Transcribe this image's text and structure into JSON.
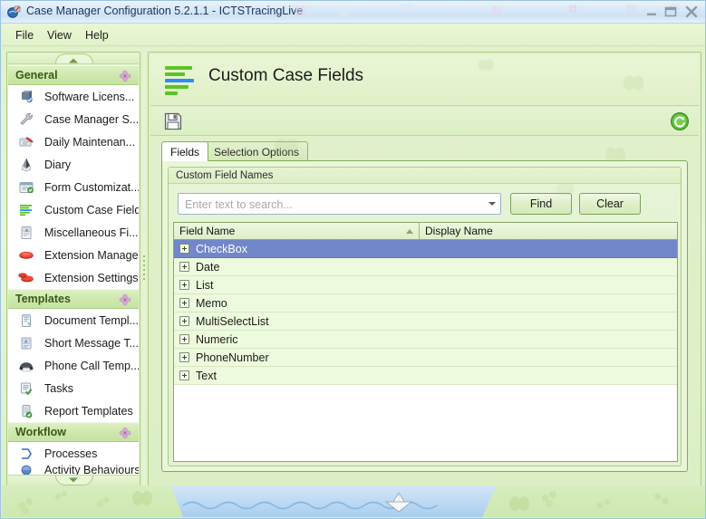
{
  "window": {
    "title": "Case Manager Configuration 5.2.1.1 - ICTSTracingLive",
    "app_icon": "app-icon",
    "controls": {
      "minimize": "minimize-button",
      "maximize": "maximize-button",
      "close": "close-button"
    }
  },
  "menubar": {
    "items": [
      {
        "label": "File"
      },
      {
        "label": "View"
      },
      {
        "label": "Help"
      }
    ]
  },
  "sidebar": {
    "scroll_up": "scroll-up-arrow",
    "scroll_down": "scroll-down-arrow",
    "groups": [
      {
        "title": "General",
        "icon": "flower-icon",
        "items": [
          {
            "label": "Software Licens...",
            "icon": "software-license-icon"
          },
          {
            "label": "Case Manager S...",
            "icon": "wrench-icon"
          },
          {
            "label": "Daily Maintenan...",
            "icon": "maintenance-icon"
          },
          {
            "label": "Diary",
            "icon": "diary-icon"
          },
          {
            "label": "Form Customizat...",
            "icon": "form-customization-icon"
          },
          {
            "label": "Custom Case Fields",
            "icon": "custom-case-fields-icon"
          },
          {
            "label": "Miscellaneous Fi...",
            "icon": "miscellaneous-files-icon"
          },
          {
            "label": "Extension Manager",
            "icon": "extension-manager-icon"
          },
          {
            "label": "Extension Settings",
            "icon": "extension-settings-icon"
          }
        ]
      },
      {
        "title": "Templates",
        "icon": "flower-icon",
        "items": [
          {
            "label": "Document Templ...",
            "icon": "document-template-icon"
          },
          {
            "label": "Short Message T...",
            "icon": "short-message-template-icon"
          },
          {
            "label": "Phone Call Temp...",
            "icon": "phone-call-template-icon"
          },
          {
            "label": "Tasks",
            "icon": "tasks-icon"
          },
          {
            "label": "Report Templates",
            "icon": "report-templates-icon"
          }
        ]
      },
      {
        "title": "Workflow",
        "icon": "flower-icon",
        "items": [
          {
            "label": "Processes",
            "icon": "processes-icon"
          },
          {
            "label": "Activity Behaviours",
            "icon": "activity-behaviours-icon"
          }
        ]
      }
    ]
  },
  "main": {
    "page_title": "Custom Case Fields",
    "page_icon": "custom-case-fields-icon",
    "toolbar": {
      "save_label": "Save",
      "save_icon": "save-floppy-icon",
      "refresh_label": "Refresh",
      "refresh_icon": "refresh-icon"
    },
    "tabs": [
      {
        "label": "Fields",
        "active": true
      },
      {
        "label": "Selection Options",
        "active": false
      }
    ],
    "group_title": "Custom Field Names",
    "search": {
      "value": "",
      "placeholder": "Enter text to search...",
      "find_label": "Find",
      "clear_label": "Clear"
    },
    "table": {
      "columns": [
        {
          "label": "Field Name",
          "sort": "asc"
        },
        {
          "label": "Display Name",
          "sort": "none"
        }
      ],
      "rows": [
        {
          "field_name": "CheckBox",
          "display_name": "",
          "selected": true
        },
        {
          "field_name": "Date",
          "display_name": "",
          "selected": false
        },
        {
          "field_name": "List",
          "display_name": "",
          "selected": false
        },
        {
          "field_name": "Memo",
          "display_name": "",
          "selected": false
        },
        {
          "field_name": "MultiSelectList",
          "display_name": "",
          "selected": false
        },
        {
          "field_name": "Numeric",
          "display_name": "",
          "selected": false
        },
        {
          "field_name": "PhoneNumber",
          "display_name": "",
          "selected": false
        },
        {
          "field_name": "Text",
          "display_name": "",
          "selected": false
        }
      ]
    }
  },
  "theme": {
    "accent_green": "#7fae57",
    "selection_blue": "#7287c9",
    "panel_green": "#e2f1cd",
    "title_blue": "#d9e9f7",
    "row_green": "#eefadd",
    "water_blue": "#bcd9f3"
  }
}
